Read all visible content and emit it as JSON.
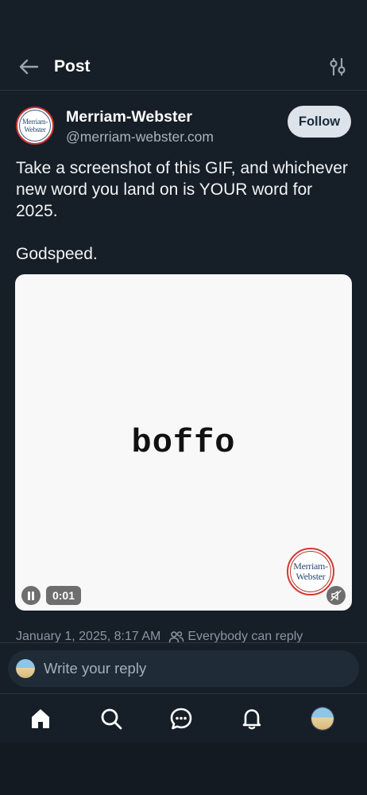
{
  "header": {
    "title": "Post",
    "back_icon": "arrow-left-icon",
    "filter_icon": "sliders-icon"
  },
  "post": {
    "author_name": "Merriam-Webster",
    "author_handle": "@merriam-webster.com",
    "follow_label": "Follow",
    "avatar_logo_line1": "Merriam-",
    "avatar_logo_line2": "Webster",
    "text": "Take a screenshot of this GIF, and whichever new word you land on is YOUR word for 2025.\n\nGodspeed.",
    "media": {
      "word": "boffo",
      "time": "0:01",
      "logo_line1": "Merriam-",
      "logo_line2": "Webster",
      "pause_icon": "pause-icon",
      "mute_icon": "mute-icon"
    },
    "timestamp": "January 1, 2025, 8:17 AM",
    "reply_setting": "Everybody can reply"
  },
  "reply": {
    "placeholder": "Write your reply"
  },
  "tabs": [
    {
      "name": "home",
      "icon": "home-icon"
    },
    {
      "name": "search",
      "icon": "search-icon"
    },
    {
      "name": "chat",
      "icon": "chat-icon"
    },
    {
      "name": "notifications",
      "icon": "bell-icon"
    },
    {
      "name": "profile",
      "icon": "avatar"
    }
  ],
  "colors": {
    "background": "#161e27",
    "follow_button": "#dce3eb",
    "muted_text": "#8b96a2",
    "logo_red": "#c9322b",
    "logo_blue": "#2b4a75"
  }
}
